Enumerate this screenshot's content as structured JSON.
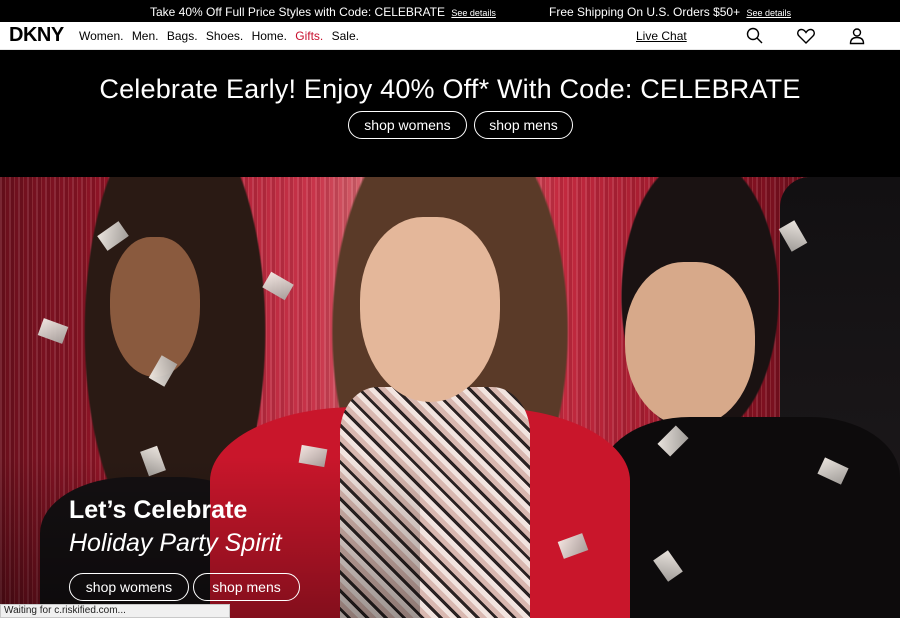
{
  "promo": {
    "left_text": "Take 40% Off Full Price Styles with Code: CELEBRATE",
    "left_link": "See details",
    "right_text": "Free Shipping On U.S. Orders $50+",
    "right_link": "See details"
  },
  "nav": {
    "logo": "DKNY",
    "items": [
      "Women.",
      "Men.",
      "Bags.",
      "Shoes.",
      "Home.",
      "Gifts.",
      "Sale."
    ],
    "live_chat": "Live Chat",
    "icons": [
      "search-icon",
      "heart-icon",
      "account-icon"
    ]
  },
  "banner": {
    "title": "Celebrate Early! Enjoy 40% Off* With Code: CELEBRATE",
    "shop_womens": "shop womens",
    "shop_mens": "shop mens"
  },
  "hero": {
    "title": "Let’s Celebrate",
    "subtitle": "Holiday Party Spirit",
    "shop_womens": "shop womens",
    "shop_mens": "shop mens"
  },
  "status_bar": "Waiting for c.riskified.com...",
  "colors": {
    "accent": "#c8102e",
    "background": "#000000",
    "nav_bg": "#ffffff"
  }
}
